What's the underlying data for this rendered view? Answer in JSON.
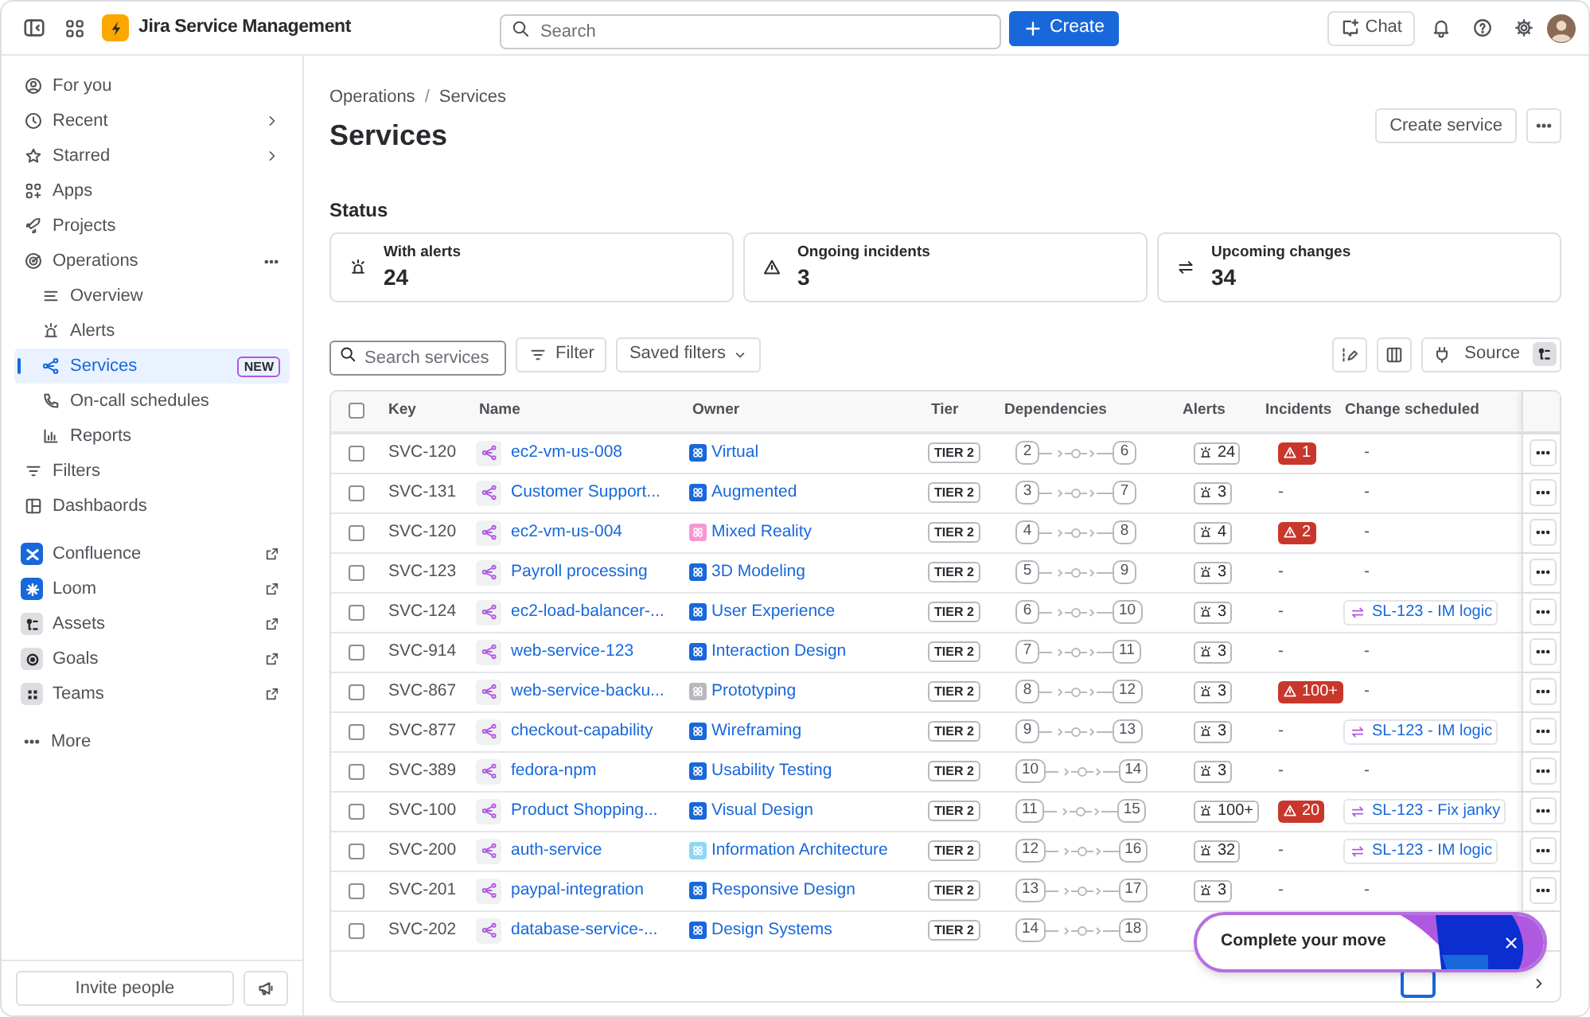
{
  "top_bar": {
    "product": "Jira Service Management",
    "search": {
      "placeholder": "Search"
    },
    "create_button": "Create",
    "chat_button": "Chat"
  },
  "sidebar": {
    "items": [
      {
        "label": "For you",
        "kind": "link",
        "selected": false
      },
      {
        "label": "Recent",
        "kind": "submenu",
        "selected": false
      },
      {
        "label": "Starred",
        "kind": "submenu",
        "selected": false
      },
      {
        "label": "Apps",
        "kind": "link",
        "selected": false
      },
      {
        "label": "Projects",
        "kind": "link",
        "selected": false
      },
      {
        "label": "Operations",
        "kind": "section",
        "selected": false,
        "children": [
          {
            "label": "Overview",
            "selected": false
          },
          {
            "label": "Alerts",
            "selected": false
          },
          {
            "label": "Services",
            "selected": true,
            "badge": "NEW"
          },
          {
            "label": "On-call schedules",
            "selected": false
          },
          {
            "label": "Reports",
            "selected": false
          }
        ]
      },
      {
        "label": "Filters",
        "kind": "link",
        "selected": false
      },
      {
        "label": "Dashbaords",
        "kind": "link",
        "selected": false
      }
    ],
    "apps": [
      {
        "label": "Confluence",
        "color": "#1868db"
      },
      {
        "label": "Loom",
        "color": "#1868db"
      },
      {
        "label": "Assets",
        "color": "#dddee1"
      },
      {
        "label": "Goals",
        "color": "#dddee1"
      },
      {
        "label": "Teams",
        "color": "#dddee1"
      }
    ],
    "more": "More",
    "invite_button": "Invite people"
  },
  "breadcrumb": [
    {
      "kind": "link",
      "text": "Operations"
    },
    {
      "kind": "separator",
      "text": "/"
    },
    {
      "kind": "link",
      "text": "Services"
    }
  ],
  "title": "Services",
  "create_service_button": "Create service",
  "status": {
    "heading": "Status",
    "cards": [
      {
        "label": "With alerts",
        "value": "24"
      },
      {
        "label": "Ongoing incidents",
        "value": "3"
      },
      {
        "label": "Upcoming changes",
        "value": "34"
      }
    ]
  },
  "toolbar": {
    "search": {
      "placeholder": "Search services"
    },
    "filter_button": "Filter",
    "saved_filters_button": "Saved filters",
    "source_button": "Source"
  },
  "table": {
    "columns": [
      "Key",
      "Name",
      "Owner",
      "Tier",
      "Dependencies",
      "Alerts",
      "Incidents",
      "Change scheduled"
    ],
    "all_checked": false,
    "rows": [
      {
        "checked": false,
        "key": "SVC-120",
        "name": "ec2-vm-us-008",
        "owner": {
          "name": "Virtual",
          "color": "#1868db"
        },
        "tier": "TIER 2",
        "dependencies": [
          "2",
          "6"
        ],
        "alerts": "24",
        "incidents": {
          "kind": "badge",
          "text": "1"
        },
        "change": {
          "kind": "empty",
          "text": "-"
        }
      },
      {
        "checked": false,
        "key": "SVC-131",
        "name": "Customer Support...",
        "owner": {
          "name": "Augmented",
          "color": "#1868db"
        },
        "tier": "TIER 2",
        "dependencies": [
          "3",
          "7"
        ],
        "alerts": "3",
        "incidents": {
          "kind": "empty",
          "text": "-"
        },
        "change": {
          "kind": "empty",
          "text": "-"
        }
      },
      {
        "checked": false,
        "key": "SVC-120",
        "name": "ec2-vm-us-004",
        "owner": {
          "name": "Mixed Reality",
          "color": "#f797d2"
        },
        "tier": "TIER 2",
        "dependencies": [
          "4",
          "8"
        ],
        "alerts": "4",
        "incidents": {
          "kind": "badge",
          "text": "2"
        },
        "change": {
          "kind": "empty",
          "text": "-"
        }
      },
      {
        "checked": false,
        "key": "SVC-123",
        "name": "Payroll processing",
        "owner": {
          "name": "3D Modeling",
          "color": "#1868db"
        },
        "tier": "TIER 2",
        "dependencies": [
          "5",
          "9"
        ],
        "alerts": "3",
        "incidents": {
          "kind": "empty",
          "text": "-"
        },
        "change": {
          "kind": "empty",
          "text": "-"
        }
      },
      {
        "checked": false,
        "key": "SVC-124",
        "name": "ec2-load-balancer-...",
        "owner": {
          "name": "User Experience",
          "color": "#1868db"
        },
        "tier": "TIER 2",
        "dependencies": [
          "6",
          "10"
        ],
        "alerts": "3",
        "incidents": {
          "kind": "empty",
          "text": "-"
        },
        "change": {
          "kind": "link",
          "text": "SL-123 - IM logic"
        }
      },
      {
        "checked": false,
        "key": "SVC-914",
        "name": "web-service-123",
        "owner": {
          "name": "Interaction Design",
          "color": "#1868db"
        },
        "tier": "TIER 2",
        "dependencies": [
          "7",
          "11"
        ],
        "alerts": "3",
        "incidents": {
          "kind": "empty",
          "text": "-"
        },
        "change": {
          "kind": "empty",
          "text": "-"
        }
      },
      {
        "checked": false,
        "key": "SVC-867",
        "name": "web-service-backu...",
        "owner": {
          "name": "Prototyping",
          "color": "#b7b9be"
        },
        "tier": "TIER 2",
        "dependencies": [
          "8",
          "12"
        ],
        "alerts": "3",
        "incidents": {
          "kind": "badge",
          "text": "100+"
        },
        "change": {
          "kind": "empty",
          "text": "-"
        }
      },
      {
        "checked": false,
        "key": "SVC-877",
        "name": "checkout-capability",
        "owner": {
          "name": "Wireframing",
          "color": "#1868db"
        },
        "tier": "TIER 2",
        "dependencies": [
          "9",
          "13"
        ],
        "alerts": "3",
        "incidents": {
          "kind": "empty",
          "text": "-"
        },
        "change": {
          "kind": "link",
          "text": "SL-123 - IM logic"
        }
      },
      {
        "checked": false,
        "key": "SVC-389",
        "name": "fedora-npm",
        "owner": {
          "name": "Usability Testing",
          "color": "#1868db"
        },
        "tier": "TIER 2",
        "dependencies": [
          "10",
          "14"
        ],
        "alerts": "3",
        "incidents": {
          "kind": "empty",
          "text": "-"
        },
        "change": {
          "kind": "empty",
          "text": "-"
        }
      },
      {
        "checked": false,
        "key": "SVC-100",
        "name": "Product Shopping...",
        "owner": {
          "name": "Visual Design",
          "color": "#1868db"
        },
        "tier": "TIER 2",
        "dependencies": [
          "11",
          "15"
        ],
        "alerts": "100+",
        "incidents": {
          "kind": "badge",
          "text": "20"
        },
        "change": {
          "kind": "link",
          "text": "SL-123 - Fix janky"
        }
      },
      {
        "checked": false,
        "key": "SVC-200",
        "name": "auth-service",
        "owner": {
          "name": "Information Architecture",
          "color": "#8fd8f5"
        },
        "tier": "TIER 2",
        "dependencies": [
          "12",
          "16"
        ],
        "alerts": "32",
        "incidents": {
          "kind": "empty",
          "text": "-"
        },
        "change": {
          "kind": "link",
          "text": "SL-123 - IM logic"
        }
      },
      {
        "checked": false,
        "key": "SVC-201",
        "name": "paypal-integration",
        "owner": {
          "name": "Responsive Design",
          "color": "#1868db"
        },
        "tier": "TIER 2",
        "dependencies": [
          "13",
          "17"
        ],
        "alerts": "3",
        "incidents": {
          "kind": "empty",
          "text": "-"
        },
        "change": {
          "kind": "empty",
          "text": "-"
        }
      },
      {
        "checked": false,
        "key": "SVC-202",
        "name": "database-service-...",
        "owner": {
          "name": "Design Systems",
          "color": "#1868db"
        },
        "tier": "TIER 2",
        "dependencies": [
          "14",
          "18"
        ]
      }
    ]
  },
  "toast": {
    "message": "Complete your move"
  }
}
